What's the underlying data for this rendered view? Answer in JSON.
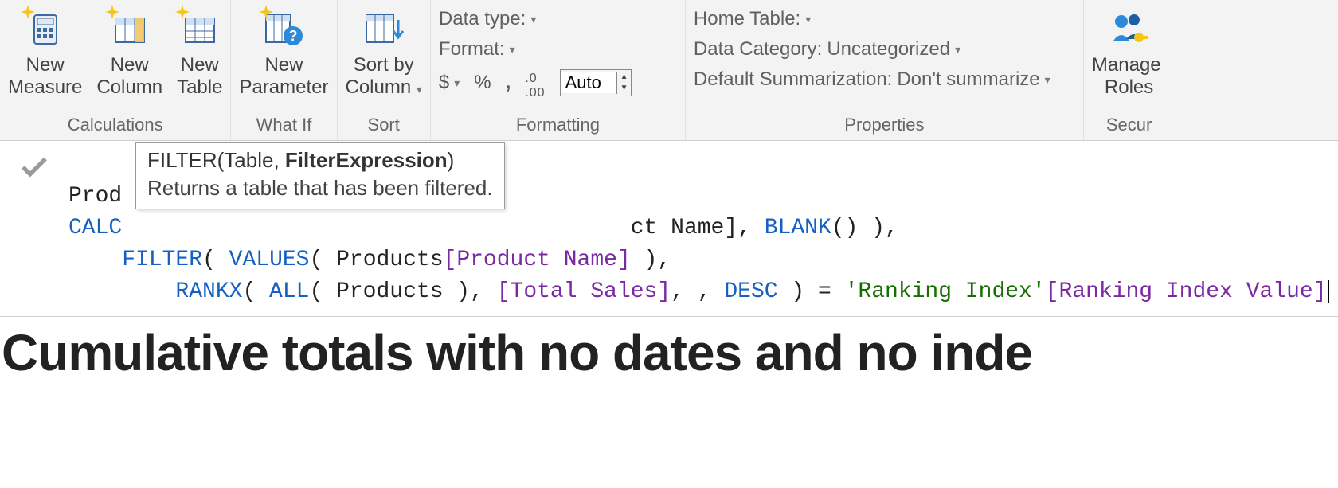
{
  "ribbon": {
    "calculations": {
      "label": "Calculations",
      "new_measure": "New\nMeasure",
      "new_column": "New\nColumn",
      "new_table": "New\nTable"
    },
    "whatif": {
      "label": "What If",
      "new_parameter": "New\nParameter"
    },
    "sort": {
      "label": "Sort",
      "sort_by_column": "Sort by\nColumn"
    },
    "formatting": {
      "label": "Formatting",
      "data_type": "Data type:",
      "format": "Format:",
      "currency": "$",
      "percent": "%",
      "comma": ",",
      "decimal_icon": ".00",
      "decimal_places": "Auto"
    },
    "properties": {
      "label": "Properties",
      "home_table": "Home Table:",
      "data_category_label": "Data Category:",
      "data_category_value": "Uncategorized",
      "summarization_label": "Default Summarization:",
      "summarization_value": "Don't summarize"
    },
    "security": {
      "label": "Secur",
      "manage_roles": "Manage \nRoles"
    }
  },
  "tooltip": {
    "sig_prefix": "FILTER(Table, ",
    "sig_bold": "FilterExpression",
    "sig_suffix": ")",
    "desc": "Returns a table that has been filtered."
  },
  "formula": {
    "line1_prefix": "Prod",
    "line2_calc": "CALC",
    "line2_tail_a": "ct Name], ",
    "line2_blank": "BLANK",
    "line2_tail_b": "() ),",
    "line3_filter": "FILTER",
    "line3_values": "VALUES",
    "line3_tbl": "Products",
    "line3_col": "[Product Name]",
    "line4_rankx": "RANKX",
    "line4_all": "ALL",
    "line4_tbl": "Products",
    "line4_meas": "[Total Sales]",
    "line4_desc": "DESC",
    "line4_str": "'Ranking Index'",
    "line4_col": "[Ranking Index Value]"
  },
  "heading": "Cumulative totals with no dates and no inde"
}
